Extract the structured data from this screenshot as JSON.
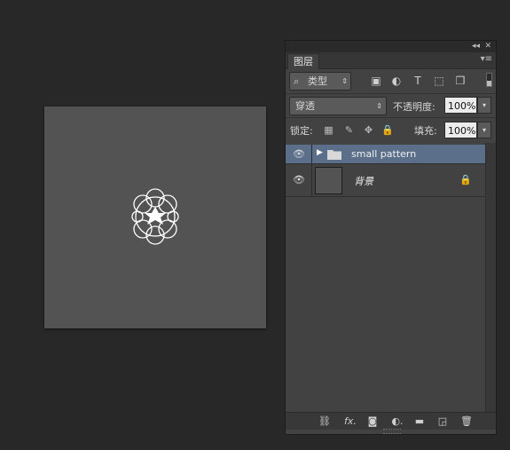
{
  "panel": {
    "collapse_glyph": "◂◂",
    "close_glyph": "✕",
    "tab_label": "图层",
    "menu_glyph": "▾≡"
  },
  "filter": {
    "search_glyph": "⌕",
    "kind_label": "类型",
    "arrow": "⇕",
    "icons": [
      "image-filter-icon",
      "adjustment-filter-icon",
      "type-filter-icon",
      "shape-filter-icon",
      "smart-object-filter-icon"
    ],
    "icon_glyphs": [
      "▣",
      "◐",
      "T",
      "⬚",
      "❐"
    ]
  },
  "blend": {
    "mode": "穿透",
    "arrow": "⇕",
    "opacity_label": "不透明度:",
    "opacity": "100%",
    "dropdown_glyph": "▾"
  },
  "lock": {
    "label": "锁定:",
    "icons": [
      "lock-transparent-icon",
      "lock-paint-icon",
      "lock-position-icon",
      "lock-all-icon"
    ],
    "icon_glyphs": [
      "▦",
      "✎",
      "✥",
      "🔒"
    ],
    "fill_label": "填充:",
    "fill": "100%"
  },
  "layers": [
    {
      "name": "small pattern",
      "type": "group",
      "visible": true,
      "selected": true
    },
    {
      "name": "背景",
      "type": "background",
      "visible": true,
      "locked": true
    }
  ],
  "layer_glyphs": {
    "eye": "👁",
    "expand": "▶",
    "lock": "🔒"
  },
  "footer": {
    "icons": [
      "link-layers-icon",
      "fx-icon",
      "add-mask-icon",
      "adjustment-layer-icon",
      "new-group-icon",
      "new-layer-icon",
      "delete-layer-icon"
    ],
    "icon_glyphs": [
      "⛓",
      "fx.",
      "◙",
      "◐.",
      "▬",
      "◲",
      "🗑"
    ]
  },
  "colors": {
    "app_bg": "#282828",
    "panel_bg": "#424242",
    "selection": "#5b6f8b",
    "canvas": "#535353"
  }
}
